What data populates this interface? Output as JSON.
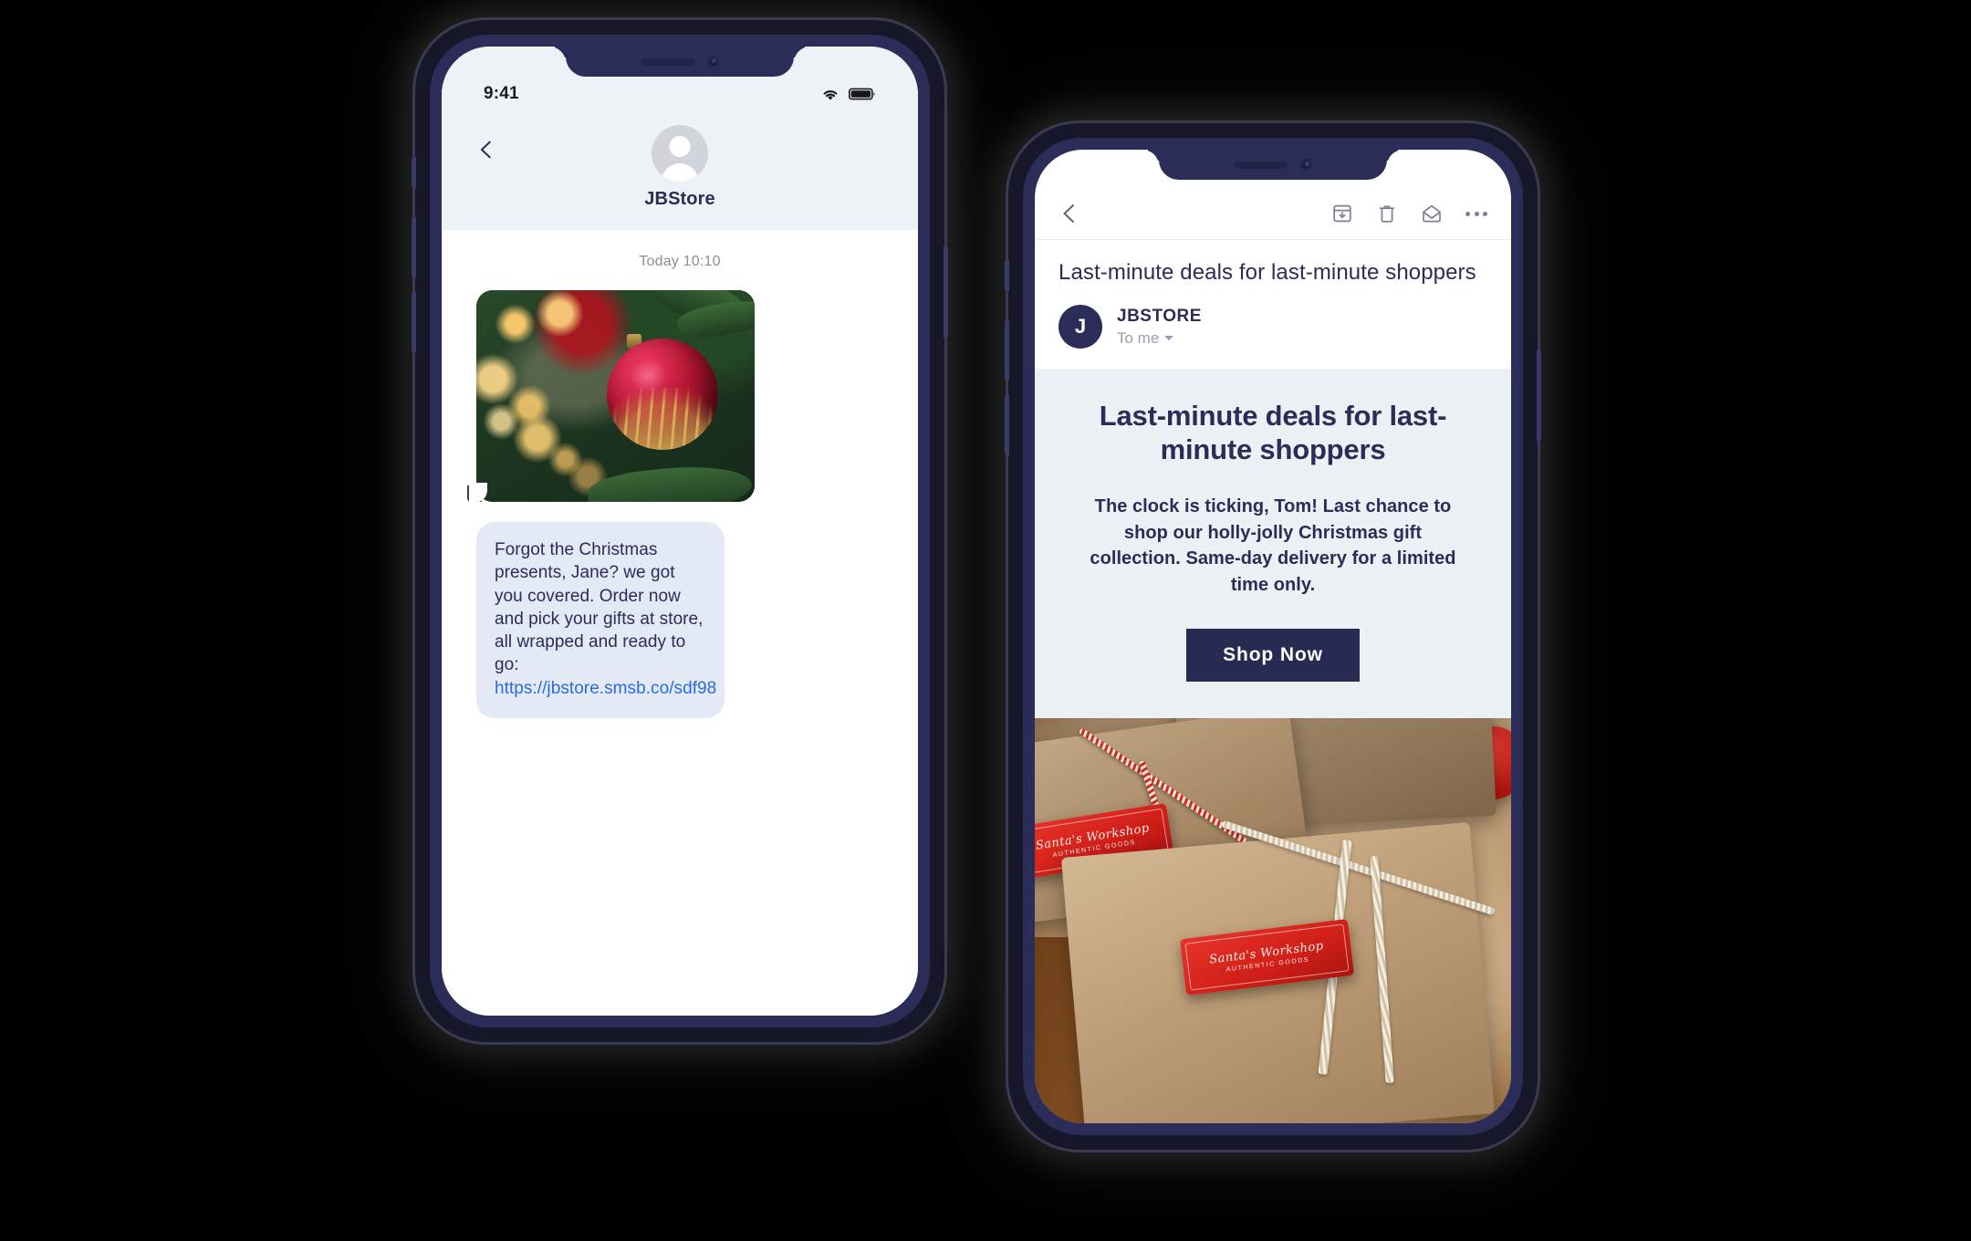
{
  "brand": {
    "navy": "#2b2c58",
    "cta_navy": "#272b53",
    "link_blue": "#2a6ae2",
    "panel_blue": "#ecf1f5",
    "bubble_blue": "#e3eaf6"
  },
  "sms_phone": {
    "status_bar": {
      "time": "9:41",
      "wifi_icon": "wifi-icon",
      "battery_icon": "battery-full-icon"
    },
    "nav": {
      "back_icon": "chevron-left-icon",
      "avatar_icon": "person-avatar-icon",
      "contact_name": "JBStore"
    },
    "conversation": {
      "timestamp": "Today 10:10",
      "image_message": {
        "alt": "Red and gold Christmas ornament hanging on a tree with bokeh lights"
      },
      "text_message": {
        "body": "Forgot the Christmas presents, Jane? we got you covered. Order now and pick your gifts at store, all wrapped and ready to go:",
        "link": "https://jbstore.smsb.co/sdf98"
      }
    }
  },
  "email_phone": {
    "toolbar": {
      "back_icon": "chevron-left-icon",
      "archive_icon": "archive-icon",
      "delete_icon": "trash-icon",
      "mark_unread_icon": "envelope-open-icon",
      "more_icon": "more-options-icon"
    },
    "message_header": {
      "subject": "Last-minute deals for last-minute shoppers",
      "sender_initial": "J",
      "sender_name": "JBSTORE",
      "recipient": "To me",
      "recipient_caret_icon": "chevron-down-icon"
    },
    "newsletter": {
      "headline": "Last-minute deals for last-minute shoppers",
      "body": "The clock is ticking, Tom! Last chance to shop our holly-jolly Christmas gift collection. Same-day delivery for a limited time only.",
      "cta_label": "Shop Now",
      "hero_image": {
        "alt": "Kraft paper wrapped gifts tied with twine and red gift tags",
        "tag_line_1": "Santa's Workshop",
        "tag_line_2": "AUTHENTIC GOODS"
      }
    }
  }
}
